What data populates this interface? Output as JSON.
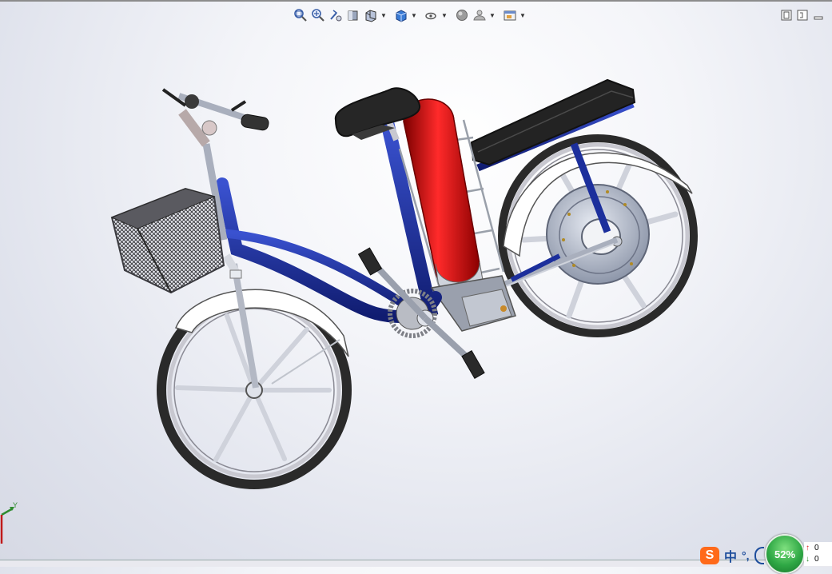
{
  "toolbar": {
    "buttons": [
      {
        "name": "zoom-to-fit-icon",
        "dropdown": false
      },
      {
        "name": "zoom-to-area-icon",
        "dropdown": false
      },
      {
        "name": "previous-view-icon",
        "dropdown": false
      },
      {
        "name": "section-view-icon",
        "dropdown": false
      },
      {
        "name": "view-orientation-icon",
        "dropdown": true
      },
      {
        "name": "display-style-icon",
        "dropdown": true
      },
      {
        "name": "hide-show-items-icon",
        "dropdown": true
      },
      {
        "name": "edit-appearance-icon",
        "dropdown": false
      },
      {
        "name": "apply-scene-icon",
        "dropdown": true
      },
      {
        "name": "view-settings-icon",
        "dropdown": true
      }
    ]
  },
  "window_controls": [
    "restore-icon",
    "tile-icon",
    "minimize-icon"
  ],
  "triad": {
    "y_label": "Y"
  },
  "taskbar": {
    "ime": {
      "logo": "S",
      "mode": "中",
      "punct": "°,"
    },
    "network": {
      "usage": "52%",
      "upload": "0",
      "download": "0"
    },
    "colors": {
      "network_green": "#2fa845",
      "ime_orange": "#ff6a1a",
      "upload_arrow": "#d22222",
      "download_arrow": "#2a8a2a"
    }
  },
  "model": {
    "name": "electric-bicycle",
    "colors": {
      "frame": "#1c2f9c",
      "battery": "#e01010",
      "seat": "#262626",
      "fender": "#ffffff",
      "tire": "#2a2a2a",
      "rim": "#c8c8d0",
      "basket": "#4a4a50",
      "hub": "#a9afbd"
    }
  }
}
